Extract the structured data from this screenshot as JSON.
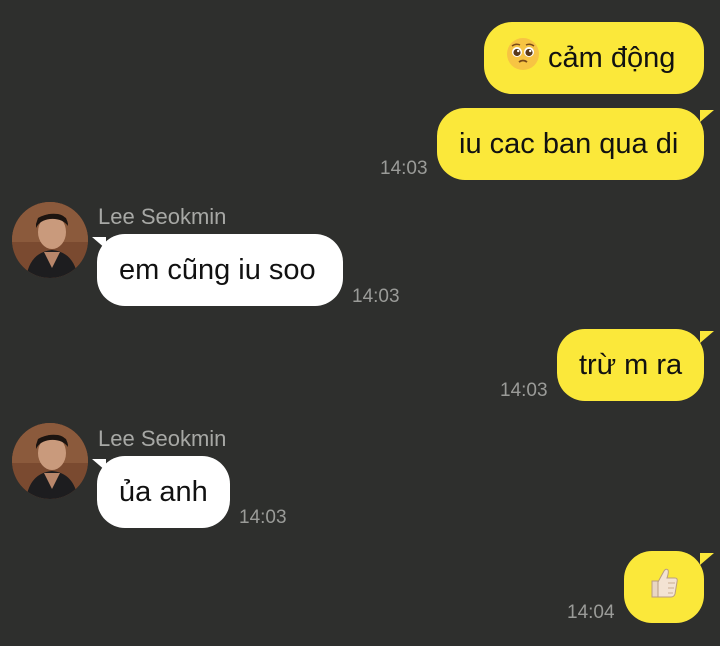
{
  "messages": [
    {
      "id": "m1",
      "direction": "outgoing",
      "text": "cảm động",
      "icon": "pleading-face-icon"
    },
    {
      "id": "m2",
      "direction": "outgoing",
      "text": "iu cac ban qua di",
      "time": "14:03"
    },
    {
      "id": "m3",
      "direction": "incoming",
      "sender": "Lee Seokmin",
      "text": "em cũng iu soo",
      "time": "14:03"
    },
    {
      "id": "m4",
      "direction": "outgoing",
      "text": "trừ m ra",
      "time": "14:03"
    },
    {
      "id": "m5",
      "direction": "incoming",
      "sender": "Lee Seokmin",
      "text": "ủa anh",
      "time": "14:03"
    },
    {
      "id": "m6",
      "direction": "outgoing",
      "icon": "thumbs-up-icon",
      "time": "14:04"
    }
  ],
  "colors": {
    "background": "#2e2f2d",
    "outgoing_bubble": "#fbe83a",
    "incoming_bubble": "#ffffff",
    "timestamp": "#9a9b98"
  }
}
